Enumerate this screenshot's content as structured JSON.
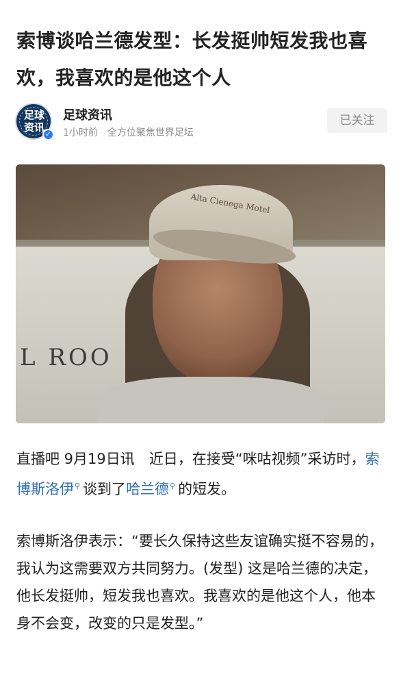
{
  "article": {
    "title": "索博谈哈兰德发型：长发挺帅短发我也喜欢，我喜欢的是他这个人"
  },
  "author": {
    "avatar_text": "足球资讯",
    "name": "足球资讯",
    "time": "1小时前",
    "tagline": "全方位聚焦世界足坛",
    "follow_label": "已关注"
  },
  "photo": {
    "cap_text": "Alta Cienega Motel",
    "sign_text": "L ROO"
  },
  "paragraph1": {
    "before": "直播吧 9月19日讯　近日，在接受“咪咕视频”采访时，",
    "link1": "索博斯洛伊",
    "middle": "谈到了",
    "link2": "哈兰德",
    "after": "的短发。"
  },
  "paragraph2": {
    "text": "索博斯洛伊表示：“要长久保持这些友谊确实挺不容易的，我认为这需要双方共同努力。(发型) 这是哈兰德的决定，他长发挺帅，短发我也喜欢。我喜欢的是他这个人，他本身不会变，改变的只是发型。”"
  },
  "colors": {
    "link": "#2f6fb6",
    "verified": "#2a7bf0"
  }
}
